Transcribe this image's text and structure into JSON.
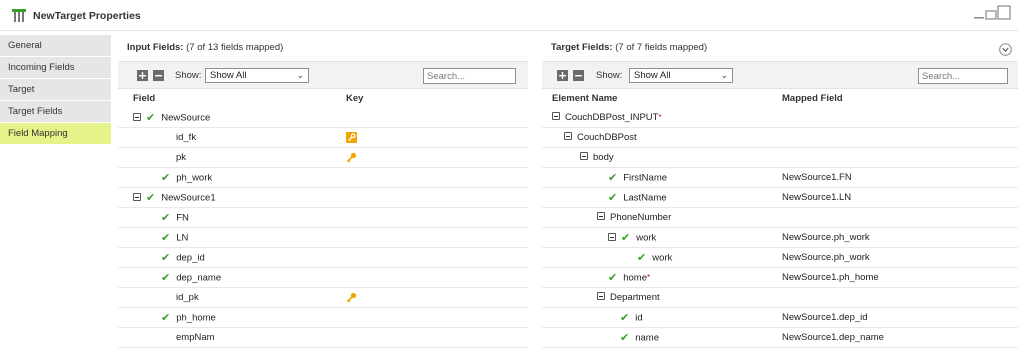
{
  "window": {
    "title": "NewTarget Properties"
  },
  "sidebar": {
    "items": [
      {
        "label": "General"
      },
      {
        "label": "Incoming Fields"
      },
      {
        "label": "Target"
      },
      {
        "label": "Target Fields"
      },
      {
        "label": "Field Mapping",
        "active": true
      }
    ]
  },
  "input_panel": {
    "title": "Input Fields:",
    "summary": "(7 of 13 fields mapped)",
    "show_label": "Show:",
    "show_value": "Show All",
    "search_placeholder": "Search...",
    "columns": {
      "field": "Field",
      "key": "Key"
    },
    "rows": [
      {
        "name": "NewSource",
        "expander": true,
        "mapped": true,
        "key": ""
      },
      {
        "name": "id_fk",
        "mapped": false,
        "key": "foreign-key-icon"
      },
      {
        "name": "pk",
        "mapped": false,
        "key": "primary-key-icon"
      },
      {
        "name": "ph_work",
        "mapped": true,
        "key": ""
      },
      {
        "name": "NewSource1",
        "expander": true,
        "mapped": true,
        "key": ""
      },
      {
        "name": "FN",
        "mapped": true,
        "key": ""
      },
      {
        "name": "LN",
        "mapped": true,
        "key": ""
      },
      {
        "name": "dep_id",
        "mapped": true,
        "key": ""
      },
      {
        "name": "dep_name",
        "mapped": true,
        "key": ""
      },
      {
        "name": "id_pk",
        "mapped": false,
        "key": "primary-key-icon"
      },
      {
        "name": "ph_home",
        "mapped": true,
        "key": ""
      },
      {
        "name": "empNam",
        "mapped": false,
        "key": ""
      }
    ]
  },
  "target_panel": {
    "title": "Target Fields:",
    "summary": "(7 of 7 fields mapped)",
    "show_label": "Show:",
    "show_value": "Show All",
    "search_placeholder": "Search...",
    "columns": {
      "element": "Element Name",
      "mapped": "Mapped Field"
    },
    "rows": [
      {
        "name": "CouchDBPost_INPUT",
        "required": true,
        "expander": true,
        "mapped": false,
        "mapped_field": ""
      },
      {
        "name": "CouchDBPost",
        "expander": true,
        "mapped": false,
        "mapped_field": ""
      },
      {
        "name": "body",
        "expander": true,
        "mapped": false,
        "mapped_field": ""
      },
      {
        "name": "FirstName",
        "mapped": true,
        "mapped_field": "NewSource1.FN"
      },
      {
        "name": "LastName",
        "mapped": true,
        "mapped_field": "NewSource1.LN"
      },
      {
        "name": "PhoneNumber",
        "expander": true,
        "mapped": false,
        "mapped_field": ""
      },
      {
        "name": "work",
        "expander": true,
        "mapped": true,
        "mapped_field": "NewSource.ph_work"
      },
      {
        "name": "work",
        "mapped": true,
        "mapped_field": "NewSource.ph_work"
      },
      {
        "name": "home",
        "required": true,
        "mapped": true,
        "mapped_field": "NewSource1.ph_home"
      },
      {
        "name": "Department",
        "expander": true,
        "mapped": false,
        "mapped_field": ""
      },
      {
        "name": "id",
        "mapped": true,
        "mapped_field": "NewSource1.dep_id"
      },
      {
        "name": "name",
        "mapped": true,
        "mapped_field": "NewSource1.dep_name"
      }
    ]
  },
  "colors": {
    "active_tab": "#e5f38a",
    "check": "#3a9d2a",
    "key": "#f0a500",
    "required": "#d0021b"
  }
}
